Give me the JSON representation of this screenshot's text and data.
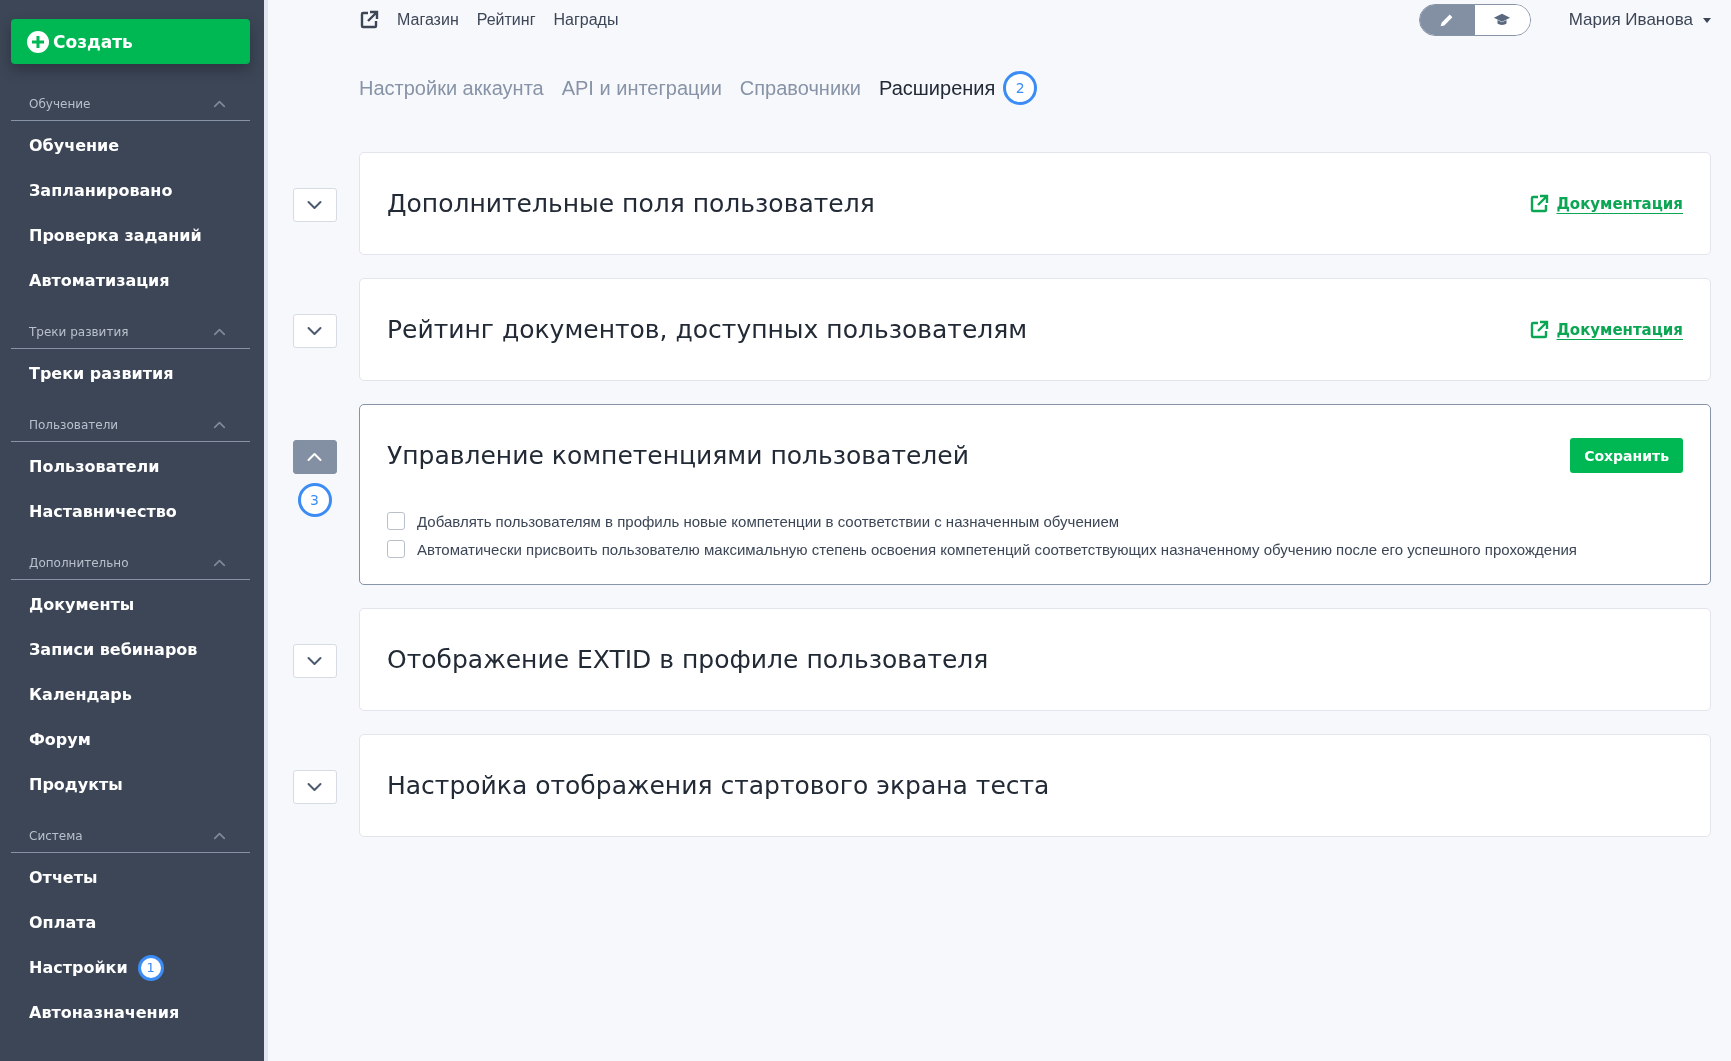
{
  "sidebar": {
    "create_button": "Создать",
    "sections": [
      {
        "title": "Обучение",
        "expanded": true,
        "items": [
          {
            "label": "Обучение"
          },
          {
            "label": "Запланировано"
          },
          {
            "label": "Проверка заданий"
          },
          {
            "label": "Автоматизация"
          }
        ]
      },
      {
        "title": "Треки развития",
        "expanded": true,
        "items": [
          {
            "label": "Треки развития"
          }
        ]
      },
      {
        "title": "Пользователи",
        "expanded": true,
        "items": [
          {
            "label": "Пользователи"
          },
          {
            "label": "Наставничество"
          }
        ]
      },
      {
        "title": "Дополнительно",
        "expanded": true,
        "items": [
          {
            "label": "Документы"
          },
          {
            "label": "Записи вебинаров"
          },
          {
            "label": "Календарь"
          },
          {
            "label": "Форум"
          },
          {
            "label": "Продукты"
          }
        ]
      },
      {
        "title": "Система",
        "expanded": true,
        "items": [
          {
            "label": "Отчеты"
          },
          {
            "label": "Оплата"
          },
          {
            "label": "Настройки",
            "badge": "1"
          },
          {
            "label": "Автоназначения"
          }
        ]
      }
    ]
  },
  "top_nav": {
    "links": [
      "Магазин",
      "Рейтинг",
      "Награды"
    ],
    "mode_toggle": [
      {
        "kind": "edit",
        "selected": true
      },
      {
        "kind": "learn",
        "selected": false
      }
    ],
    "user": "Мария Иванова"
  },
  "tabs": [
    {
      "label": "Настройки аккаунта",
      "selected": false
    },
    {
      "label": "API и интеграции",
      "selected": false
    },
    {
      "label": "Справочники",
      "selected": false
    },
    {
      "label": "Расширения",
      "selected": true,
      "badge": "2"
    }
  ],
  "extensions": [
    {
      "title": "Дополнительные поля пользователя",
      "expanded": false,
      "link": "Документация"
    },
    {
      "title": "Рейтинг документов, доступных пользователям",
      "expanded": false,
      "link": "Документация"
    },
    {
      "title": "Управление компетенциями пользователей",
      "expanded": true,
      "badge": "3",
      "save_button": "Сохранить",
      "options": [
        {
          "label": "Добавлять пользователям в профиль новые компетенции в соответствии с назначенным обучением",
          "checked": false
        },
        {
          "label": "Автоматически присвоить пользователю максимальную степень освоения компетенций соответствующих назначенному обучению после его успешного прохождения",
          "checked": false
        }
      ]
    },
    {
      "title": "Отображение EXTID в профиле пользователя",
      "expanded": false
    },
    {
      "title": "Настройка отображения стартового экрана теста",
      "expanded": false
    }
  ]
}
